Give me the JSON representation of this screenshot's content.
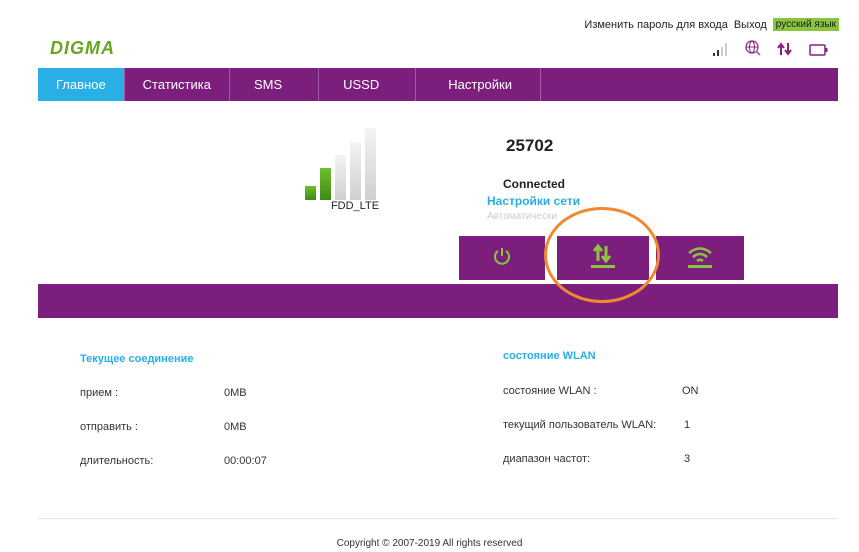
{
  "header": {
    "change_password": "Изменить пароль для входа",
    "logout": "Выход",
    "language": "русский язык",
    "logo": "DIGMA"
  },
  "nav": {
    "tabs": [
      {
        "label": "Главное",
        "active": true
      },
      {
        "label": "Статистика",
        "active": false
      },
      {
        "label": "SMS",
        "active": false
      },
      {
        "label": "USSD",
        "active": false
      },
      {
        "label": "Настройки",
        "active": false
      }
    ]
  },
  "status": {
    "network_type": "FDD_LTE",
    "operator": "25702",
    "connection_state": "Connected",
    "network_settings": "Настройки сети",
    "network_mode": "Автоматически",
    "signal_bars_active": 2,
    "signal_bars_total": 5
  },
  "colors": {
    "accent": "#7c1f7c",
    "active_tab": "#29aee6",
    "green": "#8bc53f",
    "highlight": "#f08a30"
  },
  "current_connection": {
    "title": "Текущее соединение",
    "rows": [
      {
        "label": "прием :",
        "value": "0MB"
      },
      {
        "label": "отправить :",
        "value": "0MB"
      },
      {
        "label": "длительность:",
        "value": "00:00:07"
      }
    ]
  },
  "wlan": {
    "title": "состояние WLAN",
    "rows": [
      {
        "label": "состояние WLAN :",
        "value": "ON"
      },
      {
        "label": "текущий пользователь WLAN:",
        "value": "1"
      },
      {
        "label": "диапазон частот:",
        "value": "3"
      }
    ]
  },
  "footer": {
    "copyright": "Copyright © 2007-2019 All rights reserved"
  }
}
